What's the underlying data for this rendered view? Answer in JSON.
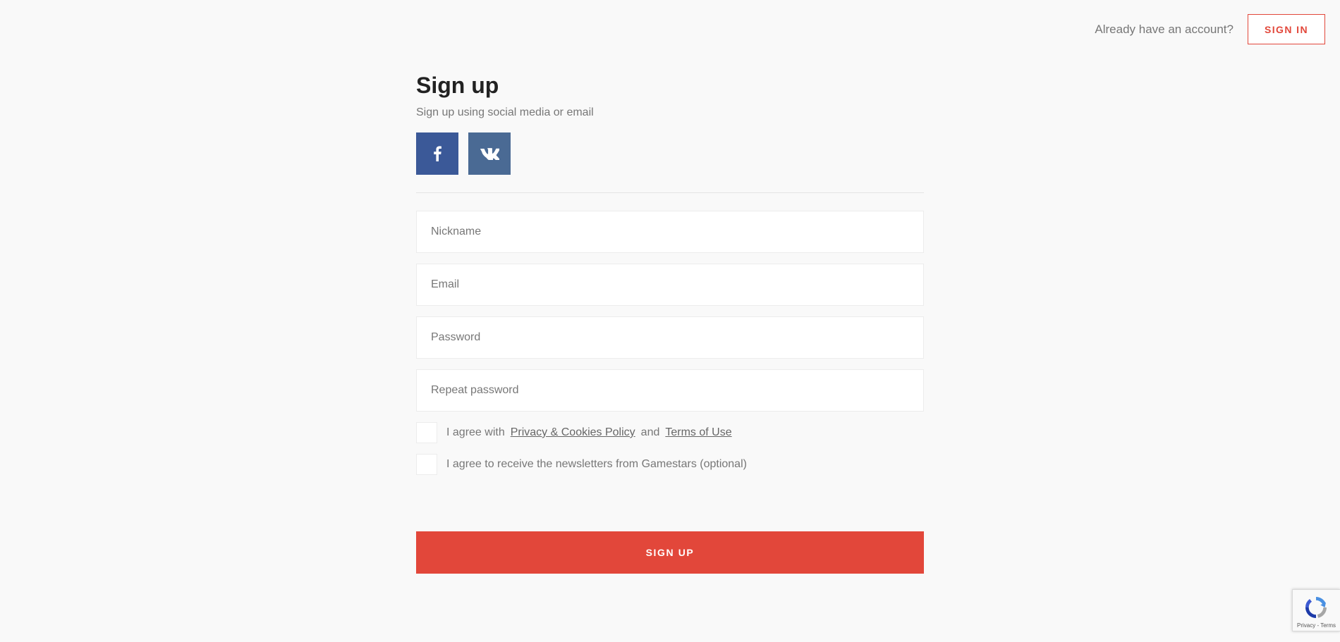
{
  "header": {
    "account_prompt": "Already have an account?",
    "signin_label": "SIGN IN"
  },
  "form": {
    "title": "Sign up",
    "subtitle": "Sign up using social media or email",
    "social": [
      {
        "name": "facebook",
        "icon": "facebook-icon",
        "color": "#3b5998"
      },
      {
        "name": "vk",
        "icon": "vk-icon",
        "color": "#4a6a94"
      }
    ],
    "fields": {
      "nickname": {
        "value": "",
        "placeholder": "Nickname"
      },
      "email": {
        "value": "",
        "placeholder": "Email"
      },
      "password": {
        "value": "",
        "placeholder": "Password"
      },
      "repeat_password": {
        "value": "",
        "placeholder": "Repeat password"
      }
    },
    "agree": {
      "prefix": "I agree with",
      "privacy_link": "Privacy & Cookies Policy",
      "and": "and",
      "terms_link": "Terms of Use",
      "checked": false
    },
    "newsletter": {
      "label": "I agree to receive the newsletters from Gamestars (optional)",
      "checked": false
    },
    "submit_label": "SIGN UP"
  },
  "recaptcha": {
    "privacy": "Privacy",
    "separator": "-",
    "terms": "Terms"
  },
  "colors": {
    "accent": "#e2473a",
    "background": "#f9f9f9",
    "facebook": "#3b5998",
    "vk": "#4a6a94"
  }
}
